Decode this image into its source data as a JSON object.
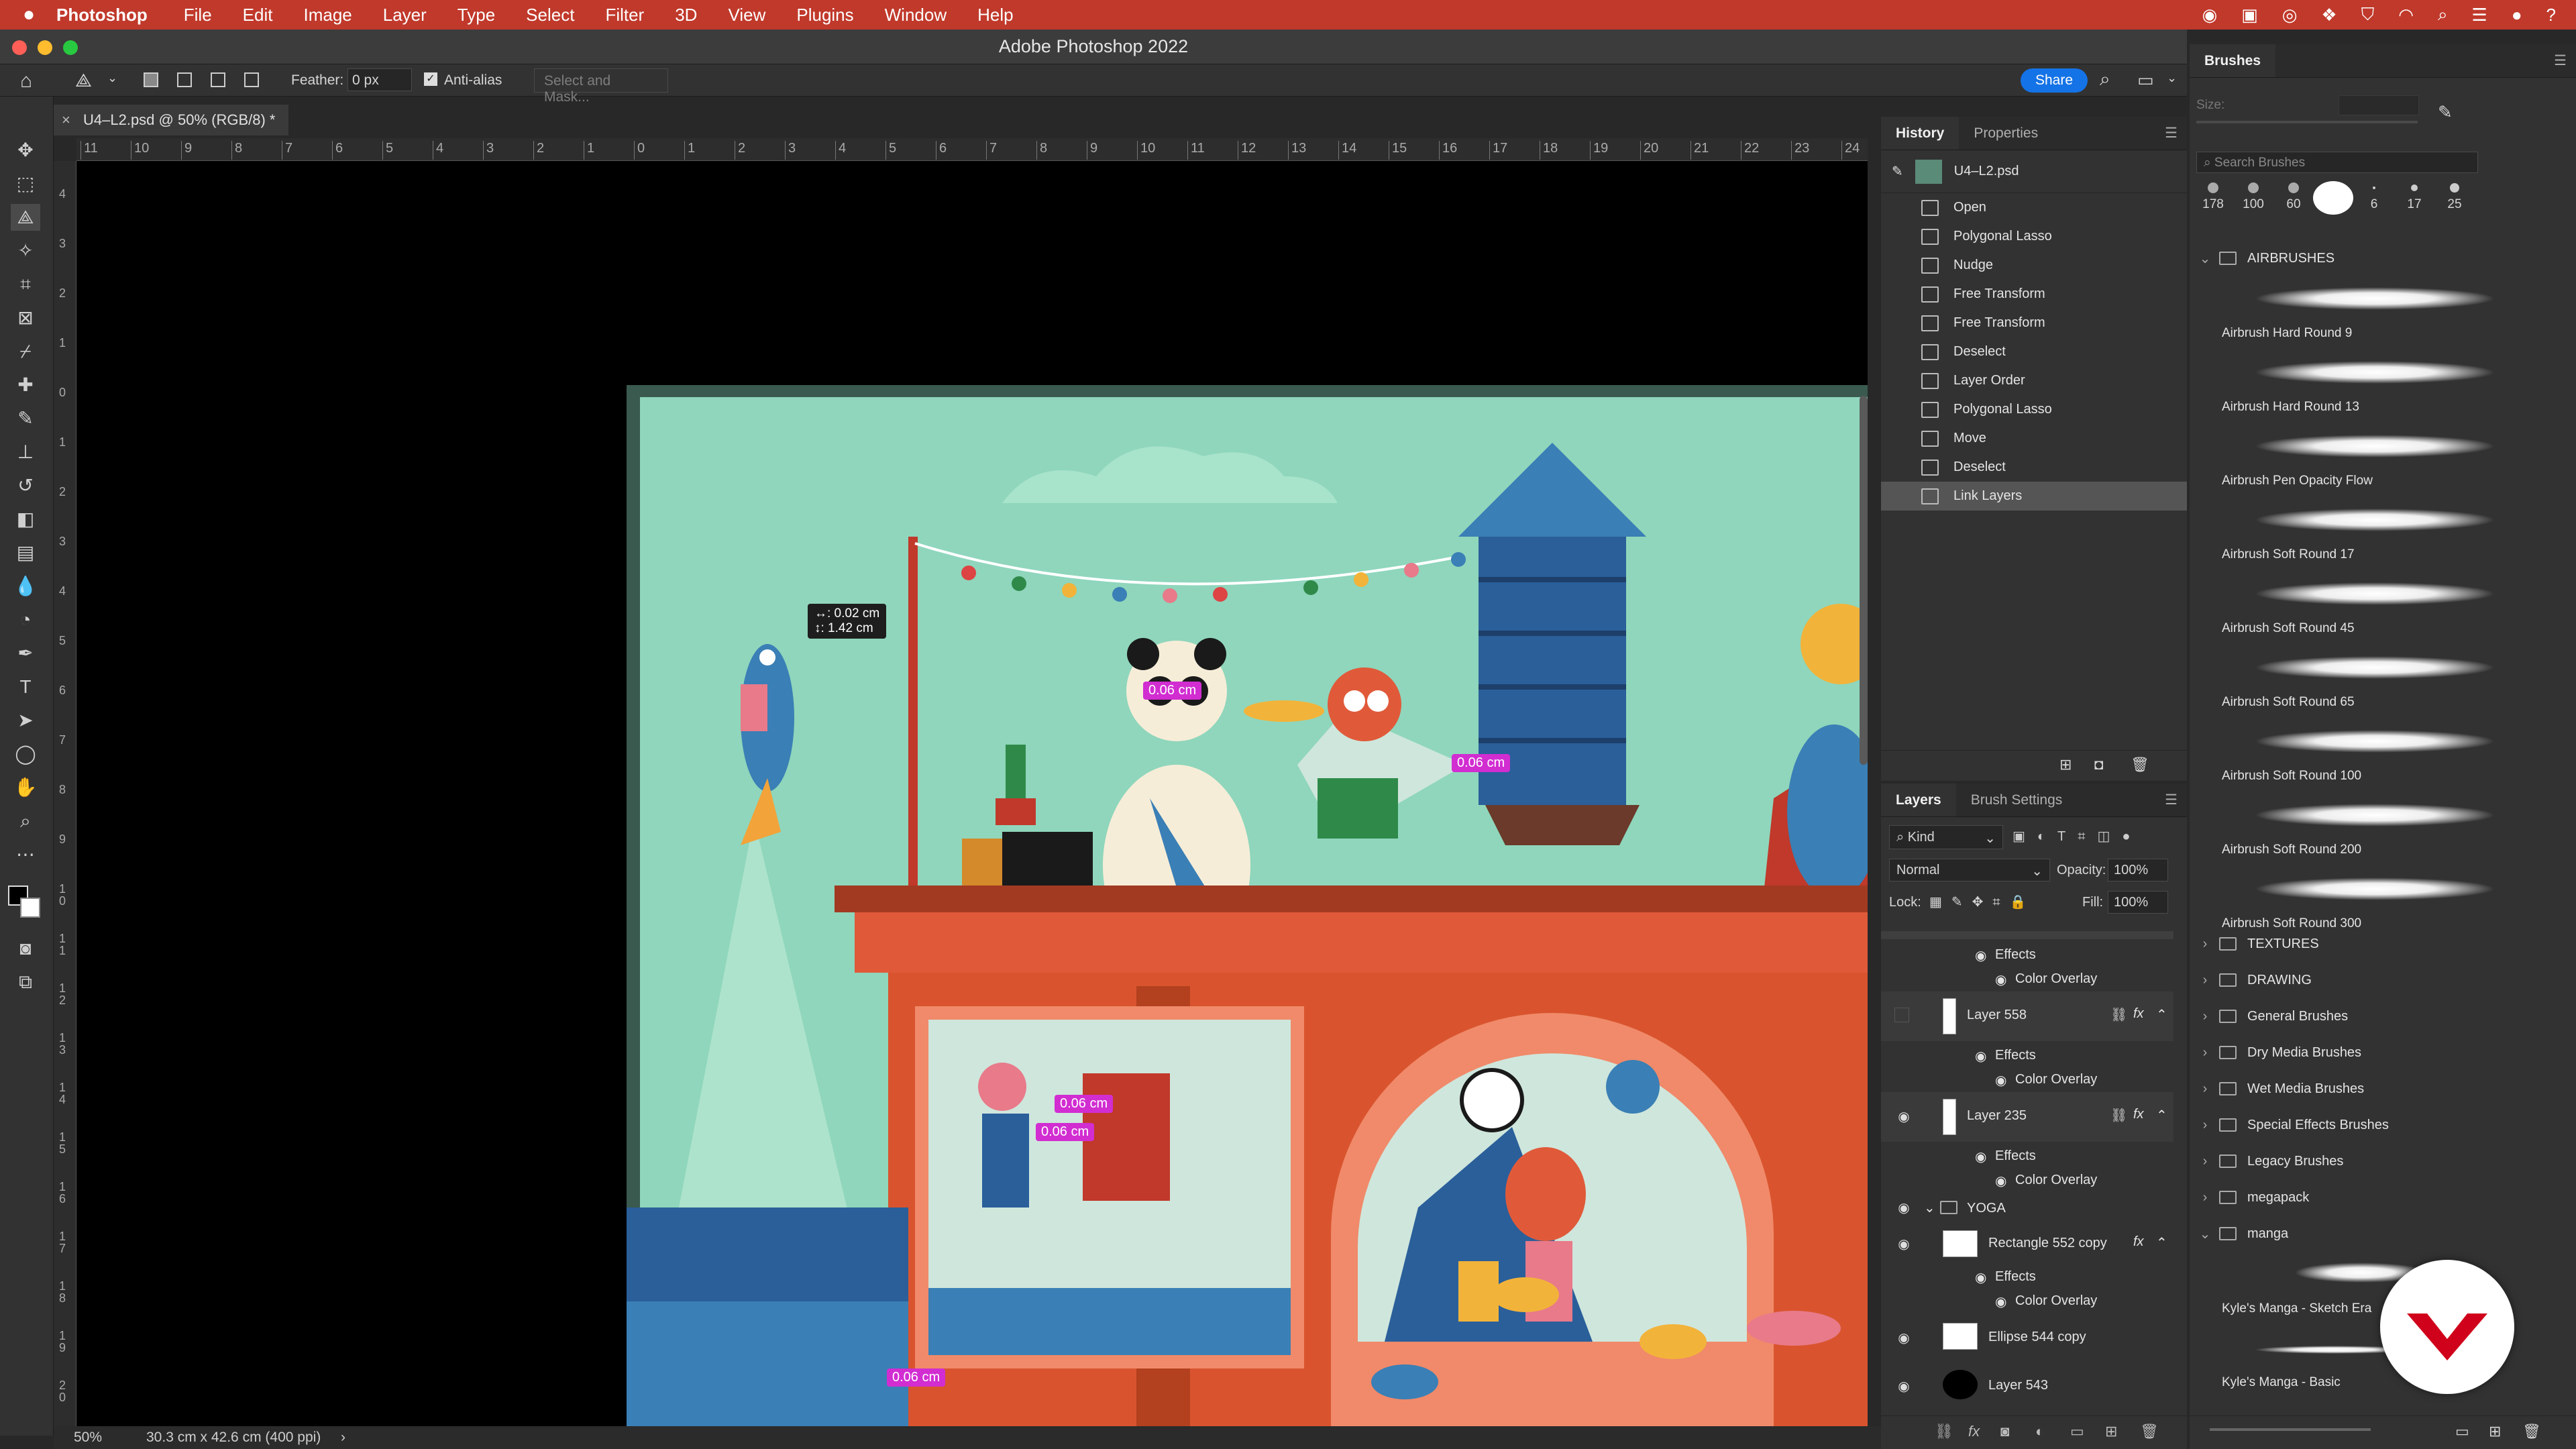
{
  "menubar": {
    "app": "Photoshop",
    "items": [
      "File",
      "Edit",
      "Image",
      "Layer",
      "Type",
      "Select",
      "Filter",
      "3D",
      "View",
      "Plugins",
      "Window",
      "Help"
    ]
  },
  "titlebar": {
    "title": "Adobe Photoshop 2022"
  },
  "options": {
    "feather_label": "Feather:",
    "feather_value": "0 px",
    "antialias_label": "Anti-alias",
    "select_mask": "Select and Mask...",
    "share": "Share"
  },
  "document": {
    "tab_title": "U4–L2.psd @ 50% (RGB/8) *",
    "ruler_h_ticks": [
      "11",
      "10",
      "9",
      "8",
      "7",
      "6",
      "5",
      "4",
      "3",
      "2",
      "1",
      "0",
      "1",
      "2",
      "3",
      "4",
      "5",
      "6",
      "7",
      "8",
      "9",
      "10",
      "11",
      "12",
      "13",
      "14",
      "15",
      "16",
      "17",
      "18",
      "19",
      "20",
      "21",
      "22",
      "23",
      "24"
    ],
    "ruler_v_ticks": [
      "4",
      "3",
      "2",
      "1",
      "0",
      "1",
      "2",
      "3",
      "4",
      "5",
      "6",
      "7",
      "8",
      "9",
      "1 0",
      "1 1",
      "1 2",
      "1 3",
      "1 4",
      "1 5",
      "1 6",
      "1 7",
      "1 8",
      "1 9",
      "2 0"
    ]
  },
  "canvas": {
    "tooltip_line1": "↔: 0.02 cm",
    "tooltip_line2": "↕: 1.42 cm",
    "meas1": "0.06 cm",
    "meas2": "0.06 cm",
    "meas3": "0.06 cm",
    "meas4": "0.06 cm",
    "meas5": "0.06 cm"
  },
  "status": {
    "zoom": "50%",
    "info": "30.3 cm x 42.6 cm (400 ppi)"
  },
  "history": {
    "tabs": [
      "History",
      "Properties"
    ],
    "snapshot": "U4–L2.psd",
    "items": [
      "Open",
      "Polygonal Lasso",
      "Nudge",
      "Free Transform",
      "Free Transform",
      "Deselect",
      "Layer Order",
      "Polygonal Lasso",
      "Move",
      "Deselect",
      "Link Layers"
    ]
  },
  "layers": {
    "tabs": [
      "Layers",
      "Brush Settings"
    ],
    "kind": "Kind",
    "blend": "Normal",
    "opacity_label": "Opacity:",
    "opacity": "100%",
    "lock_label": "Lock:",
    "fill_label": "Fill:",
    "fill": "100%",
    "rows": {
      "effects1": "Effects",
      "color_overlay1": "Color Overlay",
      "layer558": "Layer 558",
      "effects2": "Effects",
      "color_overlay2": "Color Overlay",
      "layer235": "Layer 235",
      "effects3": "Effects",
      "color_overlay3": "Color Overlay",
      "yoga": "YOGA",
      "rect552": "Rectangle 552 copy",
      "effects4": "Effects",
      "color_overlay4": "Color Overlay",
      "ellipse544": "Ellipse 544 copy",
      "layer543": "Layer 543"
    }
  },
  "brushes": {
    "tab": "Brushes",
    "size_label": "Size:",
    "search_placeholder": "Search Brushes",
    "presets": [
      "178",
      "100",
      "60",
      "",
      "6",
      "17",
      "25"
    ],
    "airbrush_folder": "AIRBRUSHES",
    "airbrushes": [
      "Airbrush Hard Round 9",
      "Airbrush Hard Round 13",
      "Airbrush Pen Opacity Flow",
      "Airbrush Soft Round 17",
      "Airbrush Soft Round 45",
      "Airbrush Soft Round 65",
      "Airbrush Soft Round 100",
      "Airbrush Soft Round 200",
      "Airbrush Soft Round 300"
    ],
    "folders": [
      "TEXTURES",
      "DRAWING",
      "General Brushes",
      "Dry Media Brushes",
      "Wet Media Brushes",
      "Special Effects Brushes",
      "Legacy Brushes",
      "megapack",
      "manga"
    ],
    "manga_items": [
      "Kyle's Manga - Sketch Era",
      "Kyle's Manga - Basic"
    ]
  }
}
